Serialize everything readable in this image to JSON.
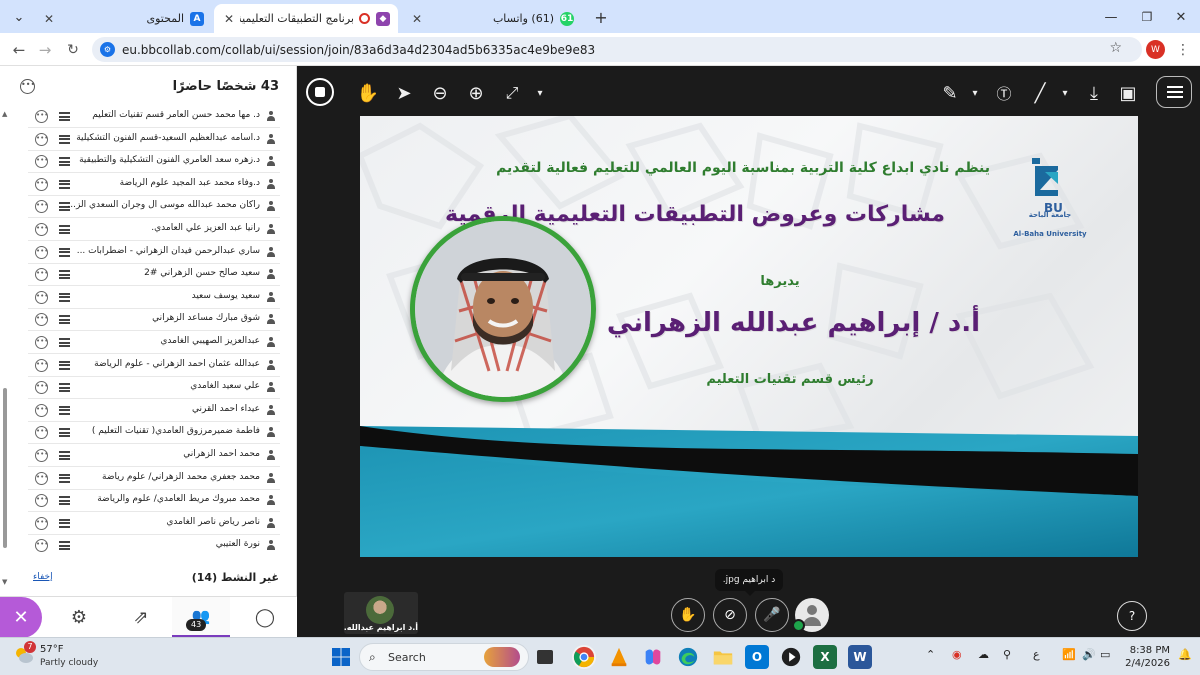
{
  "browser": {
    "tabs": [
      {
        "title": "المحتوى",
        "favicon_letter": "A",
        "favicon_color": "#1a73e8",
        "active": false
      },
      {
        "title": "برنامج التطبيقات التعليمية و",
        "favicon_color": "#8e44ad",
        "active": true
      },
      {
        "title": "(61) واتساب",
        "favicon_text": "61",
        "favicon_color": "#25d366",
        "active": false
      }
    ],
    "new_tab": "+",
    "close_glyph": "✕",
    "url": "eu.bbcollab.com/collab/ui/session/join/83a6d3a4d2304ad5b6335ac4e9be9e83",
    "profile_letter": "W"
  },
  "panel": {
    "title": "43 شخصًا حاضرًا",
    "participants": [
      "د. مها محمد حسن العامر قسم تقنيات التعليم",
      "د.أسامه عبدالعظيم السعيد-قسم الفنون التشكيلية",
      "د.زهره سعد العامري الفنون التشكيلية والتطبيقية",
      "د.وفاء محمد عبد المجيد علوم الرياضة",
      "راكان محمد عبدالله موسى ال وجران السعدي الز...",
      "رانيا عبد العزيز علي العامدي.",
      "ساري عبدالرحمن فيدان الزهراني - اضطرابات ...",
      "سعيد صالح حسن الزهراني #2",
      "سعيد يوسف سعيد",
      "شوق مبارك مساعد الزهراني",
      "عبدالعزيز الصهيبي الغامدي",
      "عبدالله عثمان احمد الزهراني - علوم الرياضة",
      "علي سعيد الغامدي",
      "عيداء احمد القرني",
      "فاطمة ضميرمرزوق العامدي( تقنيات التعليم )",
      "محمد احمد الزهراني",
      "محمد جعفري محمد الزهراني/ علوم رياضة",
      "محمد مبروك مريط العامدي/ علوم والرياضة",
      "ناصر رياض ناصر الغامدي",
      "نورة العتيبي"
    ],
    "inactive_label": "غير النشط (14)",
    "hide_label": "إخفاء",
    "attendee_count": "43"
  },
  "slide": {
    "line1": "ينظم نادي ابداع كلية التربية بمناسبة اليوم العالمي للتعليم فعالية لتقديم",
    "line2": "مشاركات وعروض التطبيقات التعليمية الرقمية",
    "line3": "يديرها",
    "line4": "أ.د / إبراهيم عبدالله الزهراني",
    "line5": "رئيس قسم تقنيات التعليم",
    "logo_ar": "جامعة الباحة",
    "logo_en": "Al-Baha University",
    "logo_bu": "BU"
  },
  "session": {
    "tooltip": "د ابراهيم jpg.",
    "thumbnail_label": "أ.د ابراهيم عبدالله..."
  },
  "taskbar": {
    "weather_badge": "7",
    "temperature": "57°F",
    "weather": "Partly cloudy",
    "search": "Search",
    "time": "8:38 PM",
    "date": "2/4/2026",
    "language": "ع"
  }
}
